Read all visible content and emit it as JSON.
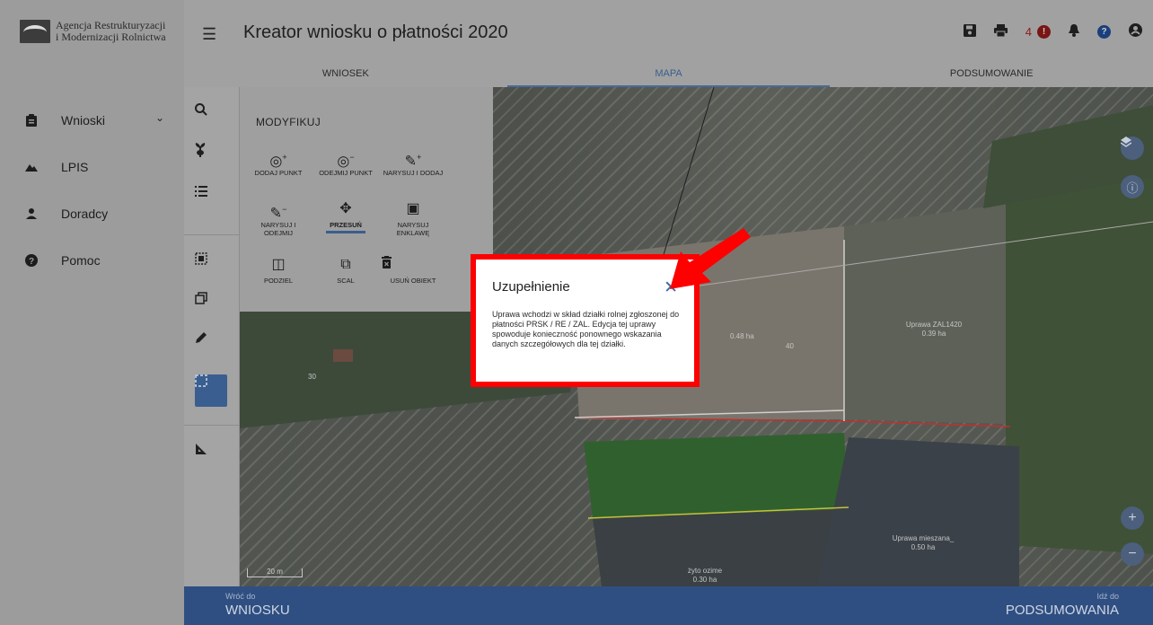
{
  "logo": {
    "line1": "Agencja Restrukturyzacji",
    "line2": "i Modernizacji Rolnictwa"
  },
  "sidebar": {
    "items": [
      {
        "label": "Wnioski",
        "icon": "clipboard-icon"
      },
      {
        "label": "LPIS",
        "icon": "mountain-icon"
      },
      {
        "label": "Doradcy",
        "icon": "person-icon"
      },
      {
        "label": "Pomoc",
        "icon": "help-icon"
      }
    ]
  },
  "header": {
    "title": "Kreator wniosku o płatności 2020",
    "notification_count": "4"
  },
  "tabs": [
    {
      "label": "WNIOSEK"
    },
    {
      "label": "MAPA"
    },
    {
      "label": "PODSUMOWANIE"
    }
  ],
  "modify": {
    "title": "MODYFIKUJ",
    "buttons": [
      {
        "label": "DODAJ PUNKT",
        "icon": "add-point-icon"
      },
      {
        "label": "ODEJMIJ PUNKT",
        "icon": "remove-point-icon"
      },
      {
        "label": "NARYSUJ I DODAJ",
        "icon": "draw-add-icon"
      },
      {
        "label": "NARYSUJ I ODEJMIJ",
        "icon": "draw-subtract-icon"
      },
      {
        "label": "PRZESUŃ",
        "icon": "move-icon"
      },
      {
        "label": "NARYSUJ ENKLAWĘ",
        "icon": "enclave-icon"
      },
      {
        "label": "PODZIEL",
        "icon": "split-icon"
      },
      {
        "label": "SCAL",
        "icon": "merge-icon"
      },
      {
        "label": "USUŃ OBIEKT",
        "icon": "delete-icon"
      }
    ]
  },
  "map": {
    "scale": "20 m",
    "labels": {
      "parcel_area": "0.48 ha",
      "parcel_num": "40",
      "zal_name": "Uprawa ZAL1420",
      "zal_area": "0.39 ha",
      "mixed_name": "Uprawa mieszana_",
      "mixed_area": "0.50 ha",
      "rye_name": "żyto ozime",
      "rye_area": "0.30 ha",
      "field_num": "30"
    }
  },
  "dialog": {
    "title": "Uzupełnienie",
    "text": "Uprawa wchodzi w skład działki rolnej zgłoszonej do płatności PRSK / RE / ZAL. Edycja tej uprawy spowoduje konieczność ponownego wskazania danych szczegółowych dla tej działki."
  },
  "footer": {
    "left_small": "Wróć do",
    "left_big": "WNIOSKU",
    "right_small": "Idź do",
    "right_big": "PODSUMOWANIA"
  },
  "colors": {
    "accent": "#3b5e8c",
    "highlight_border": "#ff0000",
    "footer": "#2f4f82"
  }
}
